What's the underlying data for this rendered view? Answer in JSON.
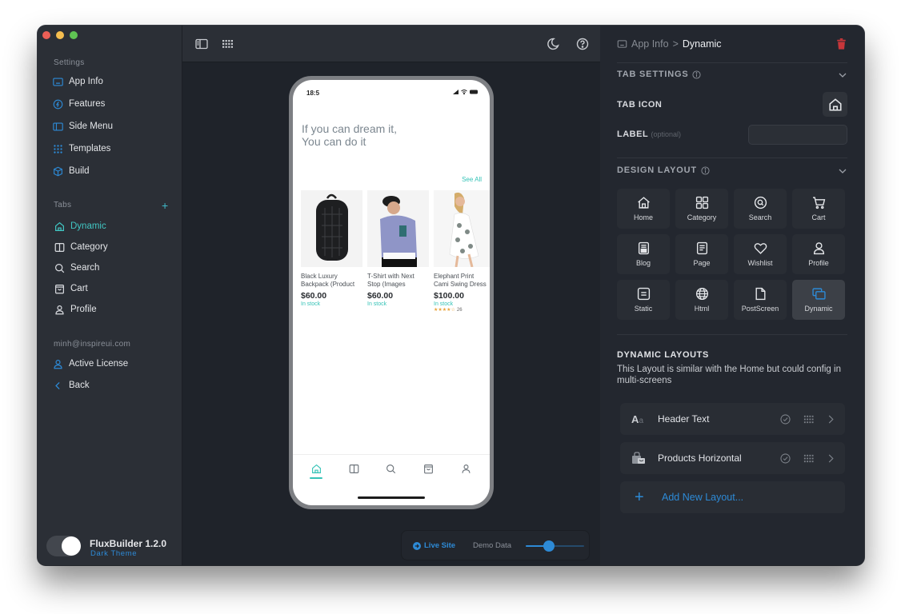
{
  "sidebar": {
    "settings_label": "Settings",
    "settings_items": [
      {
        "label": "App Info",
        "icon": "app-info-icon"
      },
      {
        "label": "Features",
        "icon": "features-icon"
      },
      {
        "label": "Side Menu",
        "icon": "side-menu-icon"
      },
      {
        "label": "Templates",
        "icon": "templates-icon"
      },
      {
        "label": "Build",
        "icon": "build-icon"
      }
    ],
    "tabs_label": "Tabs",
    "add_tab_symbol": "+",
    "tab_items": [
      {
        "label": "Dynamic",
        "icon": "home-icon",
        "active": true
      },
      {
        "label": "Category",
        "icon": "category-icon"
      },
      {
        "label": "Search",
        "icon": "search-icon"
      },
      {
        "label": "Cart",
        "icon": "cart-icon"
      },
      {
        "label": "Profile",
        "icon": "profile-icon"
      }
    ],
    "account_email": "minh@inspireui.com",
    "account_items": [
      {
        "label": "Active License",
        "icon": "user-icon"
      },
      {
        "label": "Back",
        "icon": "chevron-left-icon"
      }
    ],
    "footer": {
      "app_name": "FluxBuilder 1.2.0",
      "theme_label": "Dark Theme",
      "dark_theme_on": true
    }
  },
  "preview": {
    "status_time": "18:5",
    "headline_line1": "If  you can dream it,",
    "headline_line2": "You can do it",
    "see_all": "See All",
    "products": [
      {
        "name1": "Black Luxury",
        "name2": "Backpack (Product",
        "price": "$60.00",
        "stock": "In stock",
        "image": "backpack"
      },
      {
        "name1": "T-Shirt with Next",
        "name2": "Stop (Images",
        "price": "$60.00",
        "stock": "In stock",
        "image": "tshirt"
      },
      {
        "name1": "Elephant Print",
        "name2": "Cami Swing Dress",
        "price": "$100.00",
        "stock": "In stock",
        "image": "dress",
        "rating_stars": "★★★★☆",
        "rating_count": "26"
      }
    ],
    "bottom_nav": [
      "home-icon",
      "category-icon",
      "search-icon",
      "cart-icon",
      "profile-icon"
    ],
    "bottom_bar": {
      "live_site": "Live Site",
      "demo_data": "Demo Data",
      "slider_value": 0.4
    }
  },
  "panel": {
    "breadcrumb_parent": "App Info",
    "breadcrumb_sep": ">",
    "breadcrumb_current": "Dynamic",
    "tab_settings": "TAB SETTINGS",
    "tab_icon_label": "TAB ICON",
    "label_label": "LABEL",
    "label_optional": "(optional)",
    "label_value": "",
    "design_layout": "DESIGN LAYOUT",
    "layouts": [
      {
        "label": "Home",
        "icon": "home-icon"
      },
      {
        "label": "Category",
        "icon": "category-icon"
      },
      {
        "label": "Search",
        "icon": "search-icon"
      },
      {
        "label": "Cart",
        "icon": "cart-icon"
      },
      {
        "label": "Blog",
        "icon": "blog-icon"
      },
      {
        "label": "Page",
        "icon": "page-icon"
      },
      {
        "label": "Wishlist",
        "icon": "heart-icon"
      },
      {
        "label": "Profile",
        "icon": "profile-icon"
      },
      {
        "label": "Static",
        "icon": "static-icon"
      },
      {
        "label": "Html",
        "icon": "globe-icon"
      },
      {
        "label": "PostScreen",
        "icon": "file-icon"
      },
      {
        "label": "Dynamic",
        "icon": "dynamic-icon",
        "selected": true
      }
    ],
    "dynamic_title": "DYNAMIC LAYOUTS",
    "dynamic_desc": "This Layout is similar with the Home but could config in multi-screens",
    "dynamic_rows": [
      {
        "label": "Header Text",
        "icon": "text-icon"
      },
      {
        "label": "Products Horizontal",
        "icon": "products-icon"
      }
    ],
    "add_layout": "Add New Layout...",
    "add_symbol": "+"
  },
  "colors": {
    "accent_teal": "#41c6c3",
    "accent_blue": "#2d8ad6",
    "danger_red": "#d63c3c"
  }
}
